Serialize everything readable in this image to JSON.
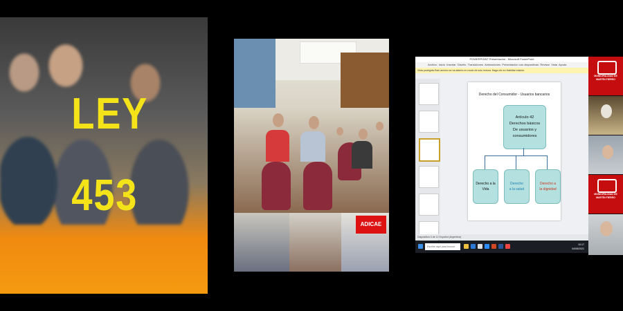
{
  "poster": {
    "title_line1": "LEY",
    "title_line2": "453",
    "title_color": "#f5e31a",
    "bottom_color": "#f59a10"
  },
  "collage": {
    "banner_text": "ADICAE"
  },
  "presentation": {
    "window_title": "POWERPOINT Presentación - Microsoft PowerPoint",
    "ribbon_tabs": [
      "Archivo",
      "Inicio",
      "Insertar",
      "Diseño",
      "Transiciones",
      "Animaciones",
      "Presentación con diapositivas",
      "Revisar",
      "Vista",
      "Ayuda"
    ],
    "notice": "Vista protegida  Este archivo se ha abierto en modo de solo lectura. Haga clic en Habilitar edición.",
    "slide": {
      "title": "Derecho del Consumidor - Usuarios bancarios",
      "main_box": [
        "Artículo 42",
        "Derechos básicos",
        "De usuarios y consumidores"
      ],
      "children": [
        {
          "line1": "Derecho a la",
          "line2": "Vida",
          "color": "#111111"
        },
        {
          "line1": "Derecho",
          "line2": "a la salud",
          "color": "#1b7fb5"
        },
        {
          "line1": "Derecho a",
          "line2": "la dignidad",
          "color": "#c8341a"
        }
      ],
      "box_fill": "#b4e0df"
    },
    "statusbar": "Diapositiva 3 de 12   Español (Argentina)",
    "taskbar": {
      "search_placeholder": "Escribe aquí para buscar",
      "clock_time": "10:17",
      "clock_date": "04/08/2021"
    }
  },
  "participants": {
    "logo_caption": "MUNICIPALIDAD DE MARTÍN FIERRO",
    "logo_color": "#c50d10"
  }
}
